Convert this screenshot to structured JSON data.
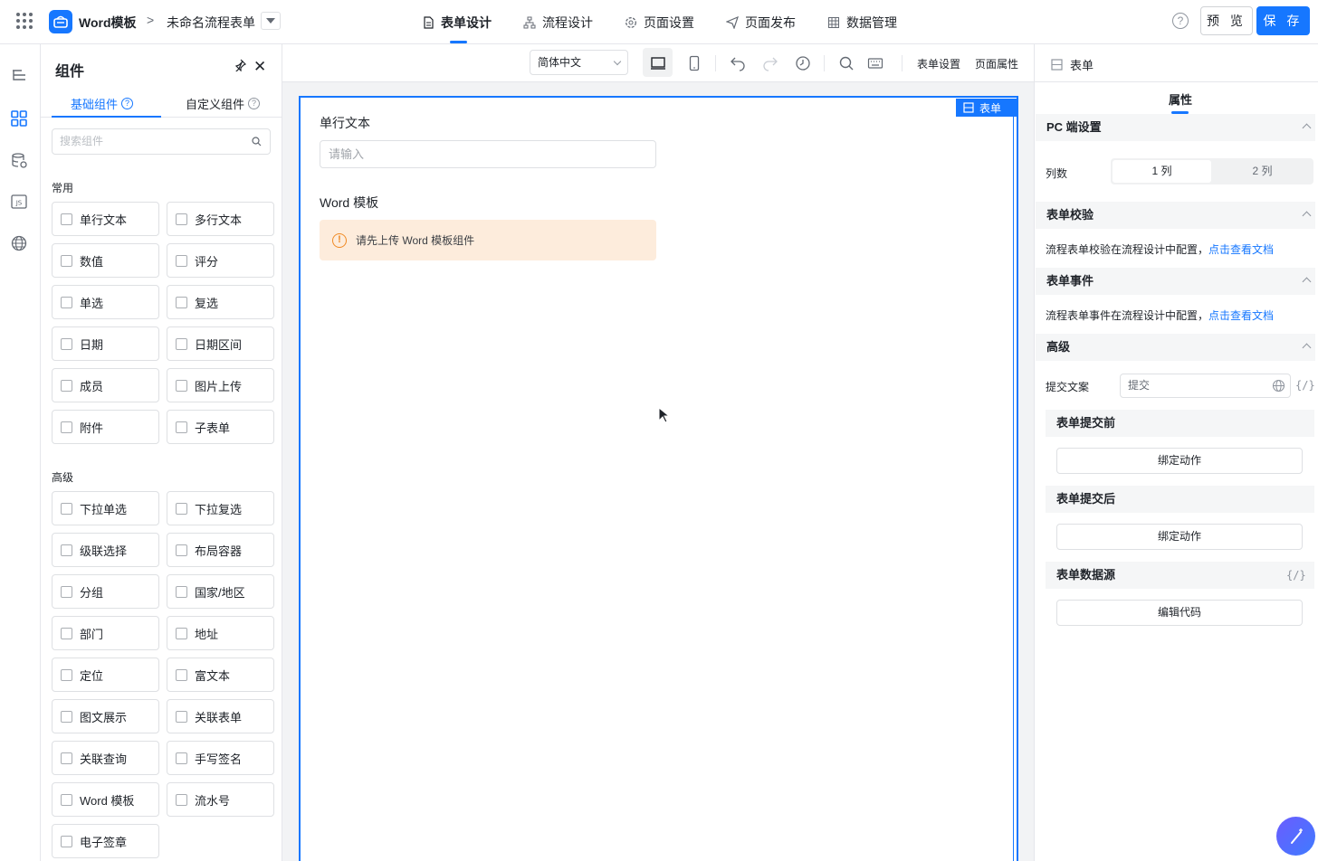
{
  "header": {
    "app_title": "Word模板",
    "form_name": "未命名流程表单",
    "tabs": [
      {
        "label": "表单设计",
        "active": true
      },
      {
        "label": "流程设计"
      },
      {
        "label": "页面设置"
      },
      {
        "label": "页面发布"
      },
      {
        "label": "数据管理"
      }
    ],
    "help": "?",
    "preview": "预 览",
    "save": "保 存",
    "accent": "#1677ff"
  },
  "components_panel": {
    "title": "组件",
    "tabs": [
      "基础组件",
      "自定义组件"
    ],
    "search_placeholder": "搜索组件",
    "common_label": "常用",
    "common": [
      "单行文本",
      "多行文本",
      "数值",
      "评分",
      "单选",
      "复选",
      "日期",
      "日期区间",
      "成员",
      "图片上传",
      "附件",
      "子表单"
    ],
    "advanced_label": "高级",
    "advanced": [
      "下拉单选",
      "下拉复选",
      "级联选择",
      "布局容器",
      "分组",
      "国家/地区",
      "部门",
      "地址",
      "定位",
      "富文本",
      "图文展示",
      "关联表单",
      "关联查询",
      "手写签名",
      "Word 模板",
      "流水号",
      "电子签章"
    ]
  },
  "toolbar": {
    "language": "简体中文",
    "form_settings": "表单设置",
    "page_props": "页面属性"
  },
  "canvas": {
    "badge": "表单",
    "field1_label": "单行文本",
    "field1_placeholder": "请输入",
    "field2_label": "Word 模板",
    "warning": "请先上传 Word 模板组件"
  },
  "props": {
    "header": "表单",
    "tab": "属性",
    "pc_section": "PC 端设置",
    "columns_label": "列数",
    "col1": "1 列",
    "col2": "2 列",
    "validate_section": "表单校验",
    "validate_text": "流程表单校验在流程设计中配置，",
    "validate_link": "点击查看文档",
    "event_section": "表单事件",
    "event_text": "流程表单事件在流程设计中配置，",
    "event_link": "点击查看文档",
    "advanced_section": "高级",
    "submit_label": "提交文案",
    "submit_value": "提交",
    "code_icon": "{/}",
    "before_submit": "表单提交前",
    "bind_action": "绑定动作",
    "after_submit": "表单提交后",
    "datasource": "表单数据源",
    "edit_code": "编辑代码"
  }
}
